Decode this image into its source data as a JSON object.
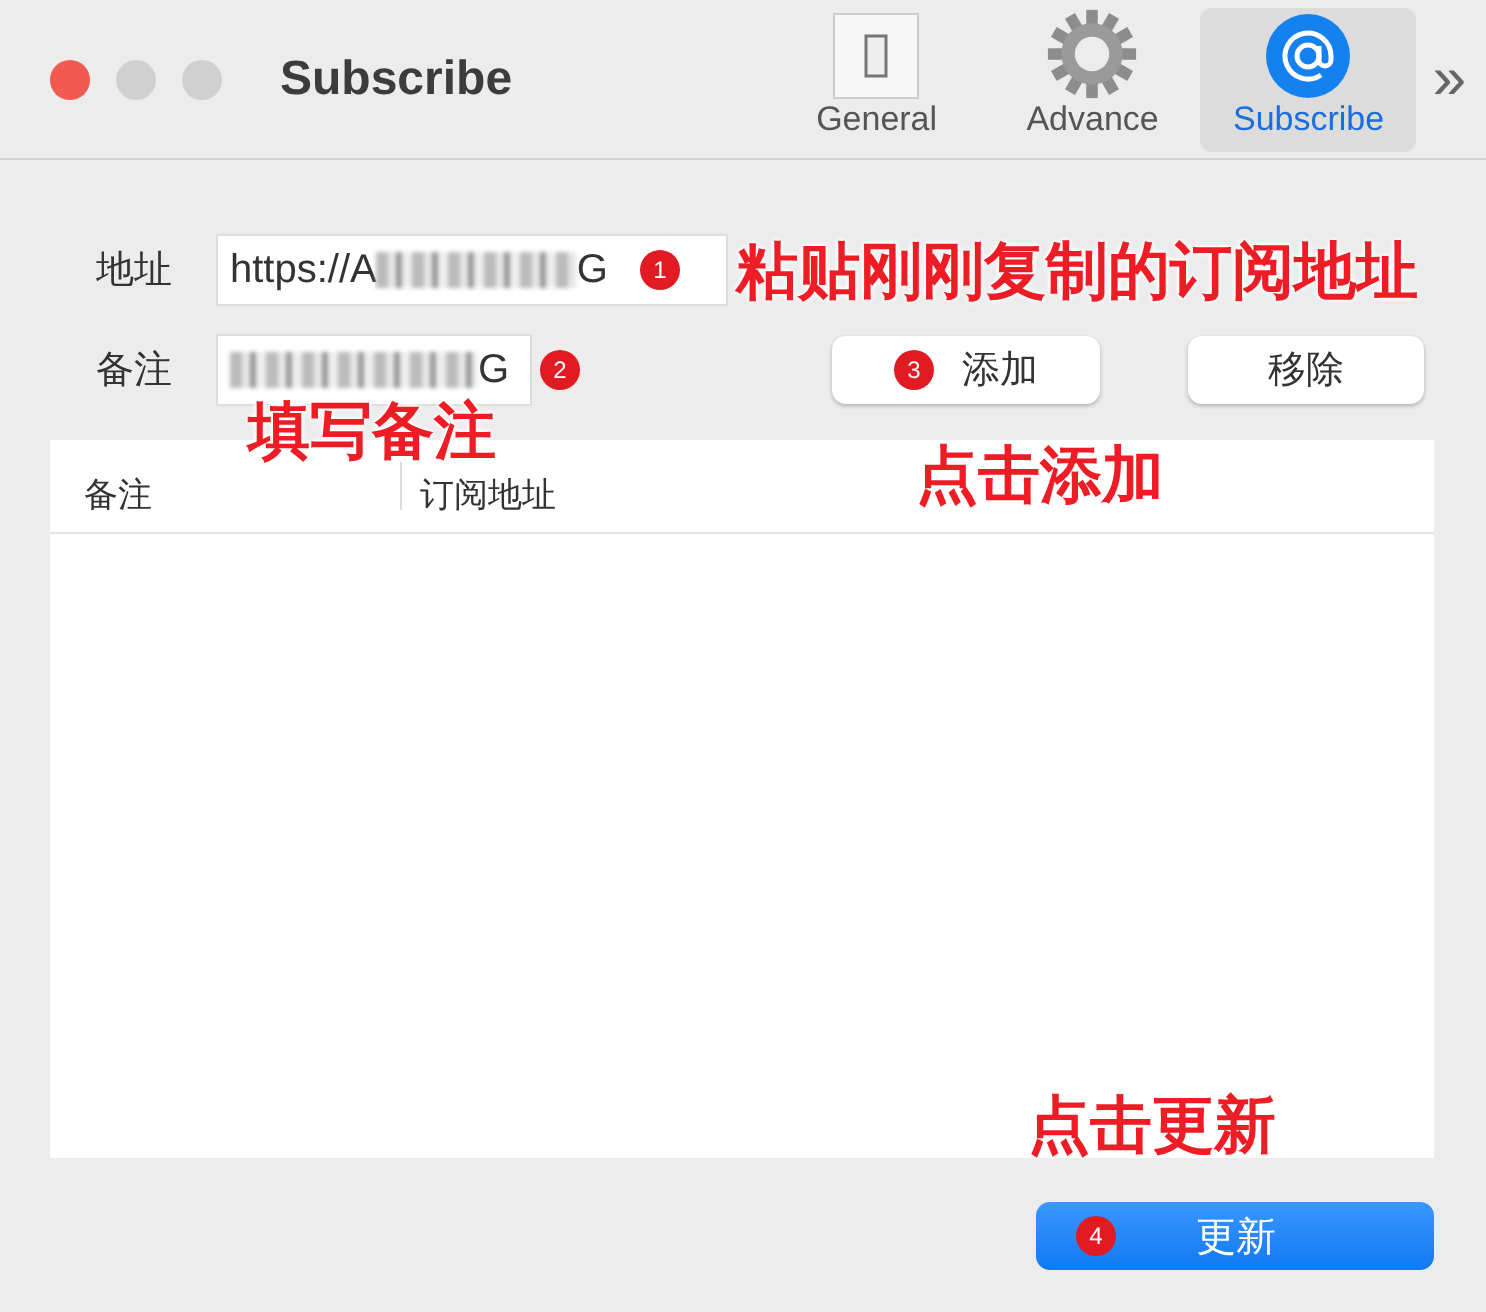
{
  "window": {
    "title": "Subscribe"
  },
  "toolbar": [
    {
      "kind": "switch",
      "label": "General",
      "selected": false
    },
    {
      "kind": "gear",
      "label": "Advance",
      "selected": false
    },
    {
      "kind": "at",
      "label": "Subscribe",
      "selected": true
    }
  ],
  "overflow": "»",
  "form": {
    "address": {
      "label": "地址",
      "value_start": "https://A",
      "value_end": "G",
      "step": "1"
    },
    "note": {
      "label": "备注",
      "value_end": "G",
      "step": "2"
    },
    "add_button": {
      "label": "添加",
      "step": "3"
    },
    "remove_button": {
      "label": "移除"
    }
  },
  "table": {
    "columns": [
      "备注",
      "订阅地址"
    ]
  },
  "update_button": {
    "label": "更新",
    "step": "4"
  },
  "annotations": [
    "粘贴刚刚复制的订阅地址",
    "填写备注",
    "点击添加",
    "点击更新"
  ]
}
